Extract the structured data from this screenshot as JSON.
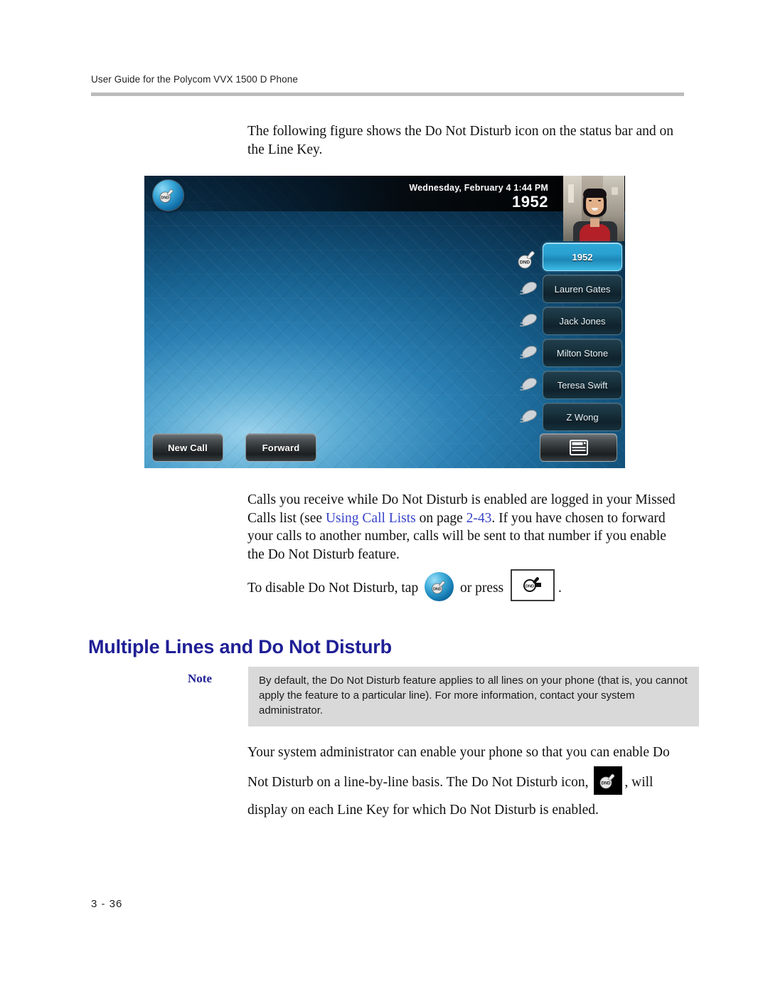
{
  "document": {
    "running_header": "User Guide for the Polycom VVX 1500 D Phone",
    "page_number": "3 - 36"
  },
  "body": {
    "intro_paragraph": "The following figure shows the Do Not Disturb icon on the status bar and on the Line Key.",
    "logged_paragraph": {
      "part1": "Calls you receive while Do Not Disturb is enabled are logged in your Missed Calls list (see ",
      "link_text": "Using Call Lists",
      "part2": " on page ",
      "link_page": "2-43",
      "part3": ". If you have chosen to forward your calls to another number, calls will be sent to that number if you enable the Do Not Disturb feature."
    },
    "disable_line": {
      "part1": "To disable Do Not Disturb, tap",
      "part2": "or press",
      "part3": "."
    },
    "heading": "Multiple Lines and Do Not Disturb",
    "note": {
      "label": "Note",
      "text": "By default, the Do Not Disturb feature applies to all lines on your phone (that is, you cannot apply the feature to a particular line). For more information, contact your system administrator."
    },
    "closing_paragraph": {
      "part1": "Your system administrator can enable your phone so that you can enable Do Not Disturb on a line-by-line basis. The Do Not Disturb icon,",
      "part2": ", will display on each Line Key for which Do Not Disturb is enabled."
    }
  },
  "figure": {
    "caption_alt": "Polycom VVX 1500 D home screen with Do Not Disturb enabled",
    "status_bar": {
      "datetime": "Wednesday, February 4  1:44 PM",
      "extension": "1952",
      "dnd_icon": "dnd-icon"
    },
    "line_keys": [
      {
        "label": "1952",
        "icon": "dnd-handset-icon",
        "active": true
      },
      {
        "label": "Lauren Gates",
        "icon": "handset-icon",
        "active": false
      },
      {
        "label": "Jack Jones",
        "icon": "handset-icon",
        "active": false
      },
      {
        "label": "Milton Stone",
        "icon": "handset-icon",
        "active": false
      },
      {
        "label": "Teresa Swift",
        "icon": "handset-icon",
        "active": false
      },
      {
        "label": "Z Wong",
        "icon": "handset-icon",
        "active": false
      }
    ],
    "soft_keys": [
      {
        "label": "New Call",
        "name": "new-call-softkey"
      },
      {
        "label": "Forward",
        "name": "forward-softkey"
      }
    ],
    "menu_softkey_icon": "window-list-icon"
  },
  "colors": {
    "heading_blue": "#1f1f96",
    "link_blue": "#3a45c9",
    "note_background": "#d9d9d9",
    "header_rule": "#bcbcbc",
    "screen_accent": "#28a0d1"
  }
}
